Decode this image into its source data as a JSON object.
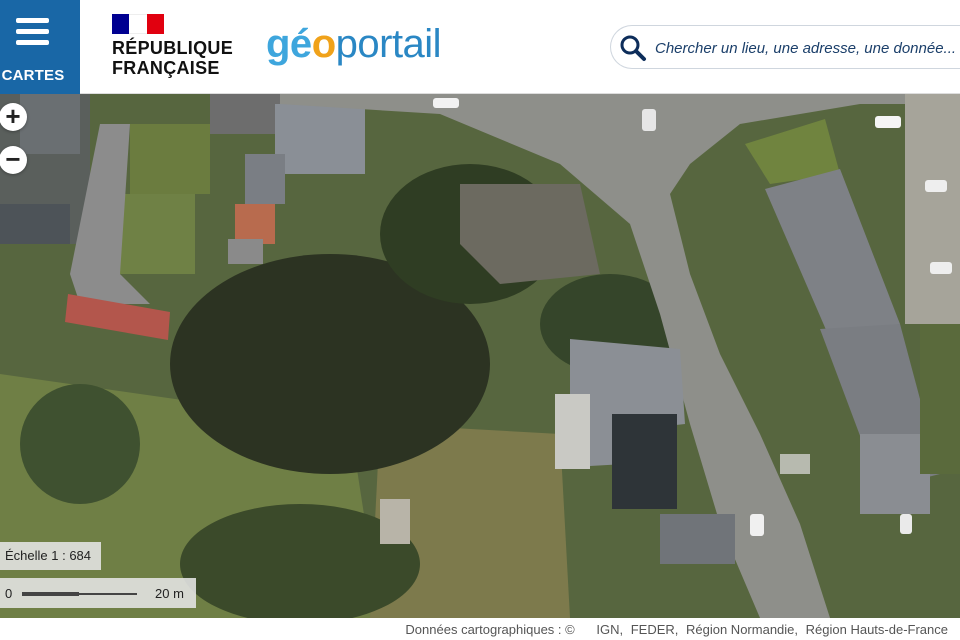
{
  "header": {
    "menu_label": "CARTES",
    "republic_line1": "RÉPUBLIQUE",
    "republic_line2": "FRANÇAISE",
    "brand": {
      "part1": "gé",
      "part2": "o",
      "part3": "portail"
    },
    "search_placeholder": "Chercher un lieu, une adresse, une donnée..."
  },
  "map": {
    "zoom_in": "+",
    "zoom_out": "−",
    "scale_text": "Échelle 1 : 684",
    "scale_start": "0",
    "scale_end": "20 m"
  },
  "attribution": {
    "prefix": "Données cartographiques : ©",
    "sources": [
      "IGN,",
      "FEDER,",
      "Région Normandie,",
      "Région Hauts-de-France"
    ]
  },
  "colors": {
    "menu_bg": "#1967a6",
    "brand_blue": "#3ea6dd",
    "brand_orange": "#f0a21a"
  }
}
